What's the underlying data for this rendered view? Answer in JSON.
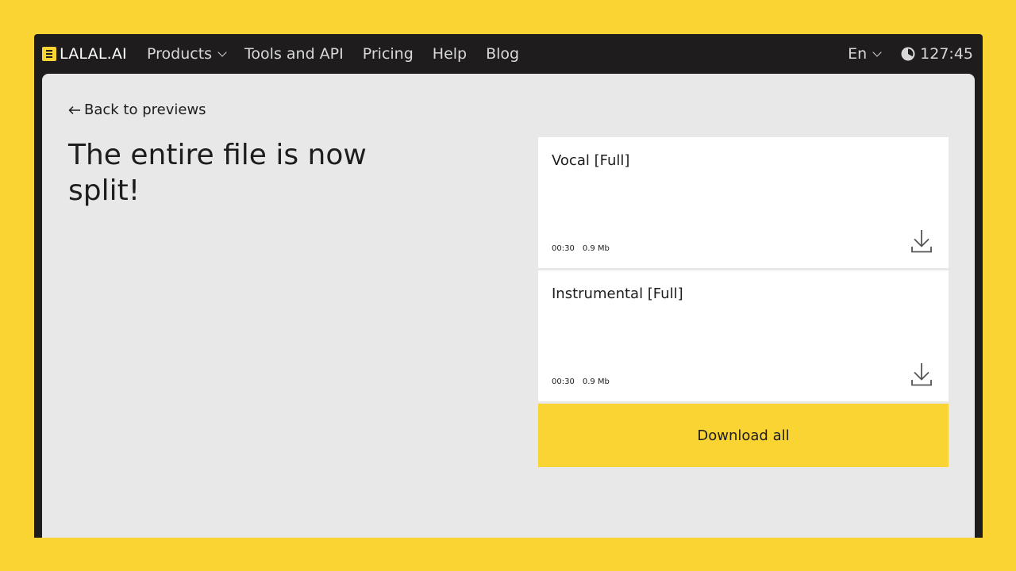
{
  "nav": {
    "logo": "LALAL.AI",
    "items": [
      {
        "label": "Products",
        "has_dropdown": true
      },
      {
        "label": "Tools and API",
        "has_dropdown": false
      },
      {
        "label": "Pricing",
        "has_dropdown": false
      },
      {
        "label": "Help",
        "has_dropdown": false
      },
      {
        "label": "Blog",
        "has_dropdown": false
      }
    ],
    "language": "En",
    "timer": "127:45"
  },
  "main": {
    "back_link": "Back to previews",
    "headline": "The entire file is now split!",
    "stems": [
      {
        "title": "Vocal [Full]",
        "duration": "00:30",
        "size": "0.9 Mb",
        "icon": "download-icon"
      },
      {
        "title": "Instrumental [Full]",
        "duration": "00:30",
        "size": "0.9 Mb",
        "icon": "download-icon"
      }
    ],
    "download_all": "Download all"
  },
  "colors": {
    "brand_yellow": "#F9D432",
    "nav_background": "#1E1C1D",
    "panel_background": "#E8E8E8",
    "card_background": "#FFFFFF"
  }
}
